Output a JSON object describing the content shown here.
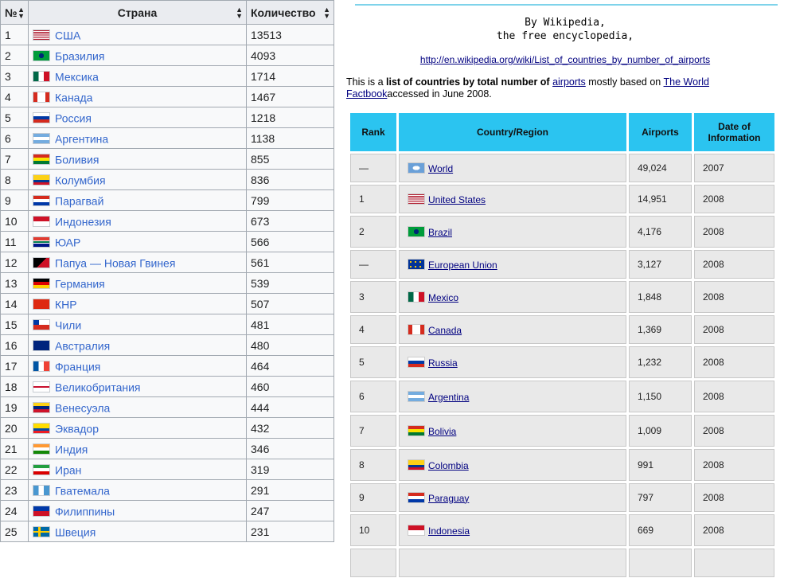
{
  "left_table": {
    "headers": {
      "num": "№",
      "country": "Страна",
      "count": "Количество"
    },
    "rows": [
      {
        "num": "1",
        "country": "США",
        "count": "13513",
        "flag": "us"
      },
      {
        "num": "2",
        "country": "Бразилия",
        "count": "4093",
        "flag": "br"
      },
      {
        "num": "3",
        "country": "Мексика",
        "count": "1714",
        "flag": "mx"
      },
      {
        "num": "4",
        "country": "Канада",
        "count": "1467",
        "flag": "ca"
      },
      {
        "num": "5",
        "country": "Россия",
        "count": "1218",
        "flag": "ru"
      },
      {
        "num": "6",
        "country": "Аргентина",
        "count": "1138",
        "flag": "ar"
      },
      {
        "num": "7",
        "country": "Боливия",
        "count": "855",
        "flag": "bo"
      },
      {
        "num": "8",
        "country": "Колумбия",
        "count": "836",
        "flag": "co"
      },
      {
        "num": "9",
        "country": "Парагвай",
        "count": "799",
        "flag": "py"
      },
      {
        "num": "10",
        "country": "Индонезия",
        "count": "673",
        "flag": "id"
      },
      {
        "num": "11",
        "country": "ЮАР",
        "count": "566",
        "flag": "za"
      },
      {
        "num": "12",
        "country": "Папуа — Новая Гвинея",
        "count": "561",
        "flag": "pg"
      },
      {
        "num": "13",
        "country": "Германия",
        "count": "539",
        "flag": "de"
      },
      {
        "num": "14",
        "country": "КНР",
        "count": "507",
        "flag": "cn"
      },
      {
        "num": "15",
        "country": "Чили",
        "count": "481",
        "flag": "cl"
      },
      {
        "num": "16",
        "country": "Австралия",
        "count": "480",
        "flag": "au"
      },
      {
        "num": "17",
        "country": "Франция",
        "count": "464",
        "flag": "fr"
      },
      {
        "num": "18",
        "country": "Великобритания",
        "count": "460",
        "flag": "gb"
      },
      {
        "num": "19",
        "country": "Венесуэла",
        "count": "444",
        "flag": "ve"
      },
      {
        "num": "20",
        "country": "Эквадор",
        "count": "432",
        "flag": "ec"
      },
      {
        "num": "21",
        "country": "Индия",
        "count": "346",
        "flag": "in"
      },
      {
        "num": "22",
        "country": "Иран",
        "count": "319",
        "flag": "ir"
      },
      {
        "num": "23",
        "country": "Гватемала",
        "count": "291",
        "flag": "gt"
      },
      {
        "num": "24",
        "country": "Филиппины",
        "count": "247",
        "flag": "ph"
      },
      {
        "num": "25",
        "country": "Швеция",
        "count": "231",
        "flag": "se"
      }
    ]
  },
  "right_page": {
    "credit_line1": "By Wikipedia,",
    "credit_line2": "the free encyclopedia,",
    "url": "http://en.wikipedia.org/wiki/List_of_countries_by_number_of_airports",
    "intro": {
      "part1": "This is a ",
      "bold": "list of countries by total number of",
      "space": " ",
      "link1": "airports",
      "part2": " mostly based on ",
      "link2": "The World Factbook",
      "part3": "accessed in June 2008."
    },
    "headers": {
      "rank": "Rank",
      "country": "Country/Region",
      "airports": "Airports",
      "date": "Date of Information"
    },
    "rows": [
      {
        "rank": "—",
        "country": "World",
        "airports": "49,024",
        "date": "2007",
        "flag": "world"
      },
      {
        "rank": "1",
        "country": "United States",
        "airports": "14,951",
        "date": "2008",
        "flag": "us"
      },
      {
        "rank": "2",
        "country": "Brazil",
        "airports": "4,176",
        "date": "2008",
        "flag": "br"
      },
      {
        "rank": "—",
        "country": "European Union",
        "airports": "3,127",
        "date": "2008",
        "flag": "eu"
      },
      {
        "rank": "3",
        "country": "Mexico",
        "airports": "1,848",
        "date": "2008",
        "flag": "mx"
      },
      {
        "rank": "4",
        "country": "Canada",
        "airports": "1,369",
        "date": "2008",
        "flag": "ca"
      },
      {
        "rank": "5",
        "country": "Russia",
        "airports": "1,232",
        "date": "2008",
        "flag": "ru"
      },
      {
        "rank": "6",
        "country": "Argentina",
        "airports": "1,150",
        "date": "2008",
        "flag": "ar"
      },
      {
        "rank": "7",
        "country": "Bolivia",
        "airports": "1,009",
        "date": "2008",
        "flag": "bo"
      },
      {
        "rank": "8",
        "country": "Colombia",
        "airports": "991",
        "date": "2008",
        "flag": "co"
      },
      {
        "rank": "9",
        "country": "Paraguay",
        "airports": "797",
        "date": "2008",
        "flag": "py"
      },
      {
        "rank": "10",
        "country": "Indonesia",
        "airports": "669",
        "date": "2008",
        "flag": "id"
      }
    ]
  }
}
